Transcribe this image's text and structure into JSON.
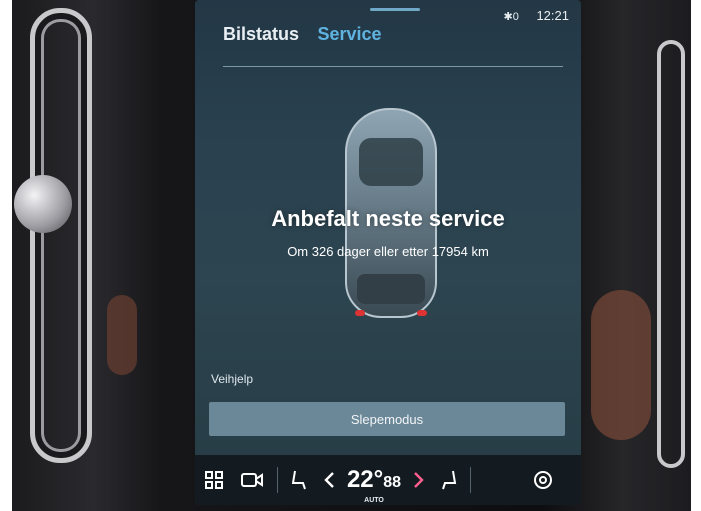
{
  "status_bar": {
    "bluetooth": "✱0",
    "time": "12:21"
  },
  "tabs": [
    {
      "label": "Bilstatus"
    },
    {
      "label": "Service"
    }
  ],
  "service": {
    "headline": "Anbefalt neste service",
    "subline": "Om 326 dager eller etter 17954 km"
  },
  "roadside": {
    "label": "Veihjelp",
    "button_label": "Slepemodus"
  },
  "climate_bar": {
    "temperature": "22°",
    "temperature_detail": "88",
    "mode": "AUTO"
  },
  "colors": {
    "accent": "#5fb3e0",
    "screen_bg": "#2a4250",
    "button_bg": "#6b8898"
  }
}
